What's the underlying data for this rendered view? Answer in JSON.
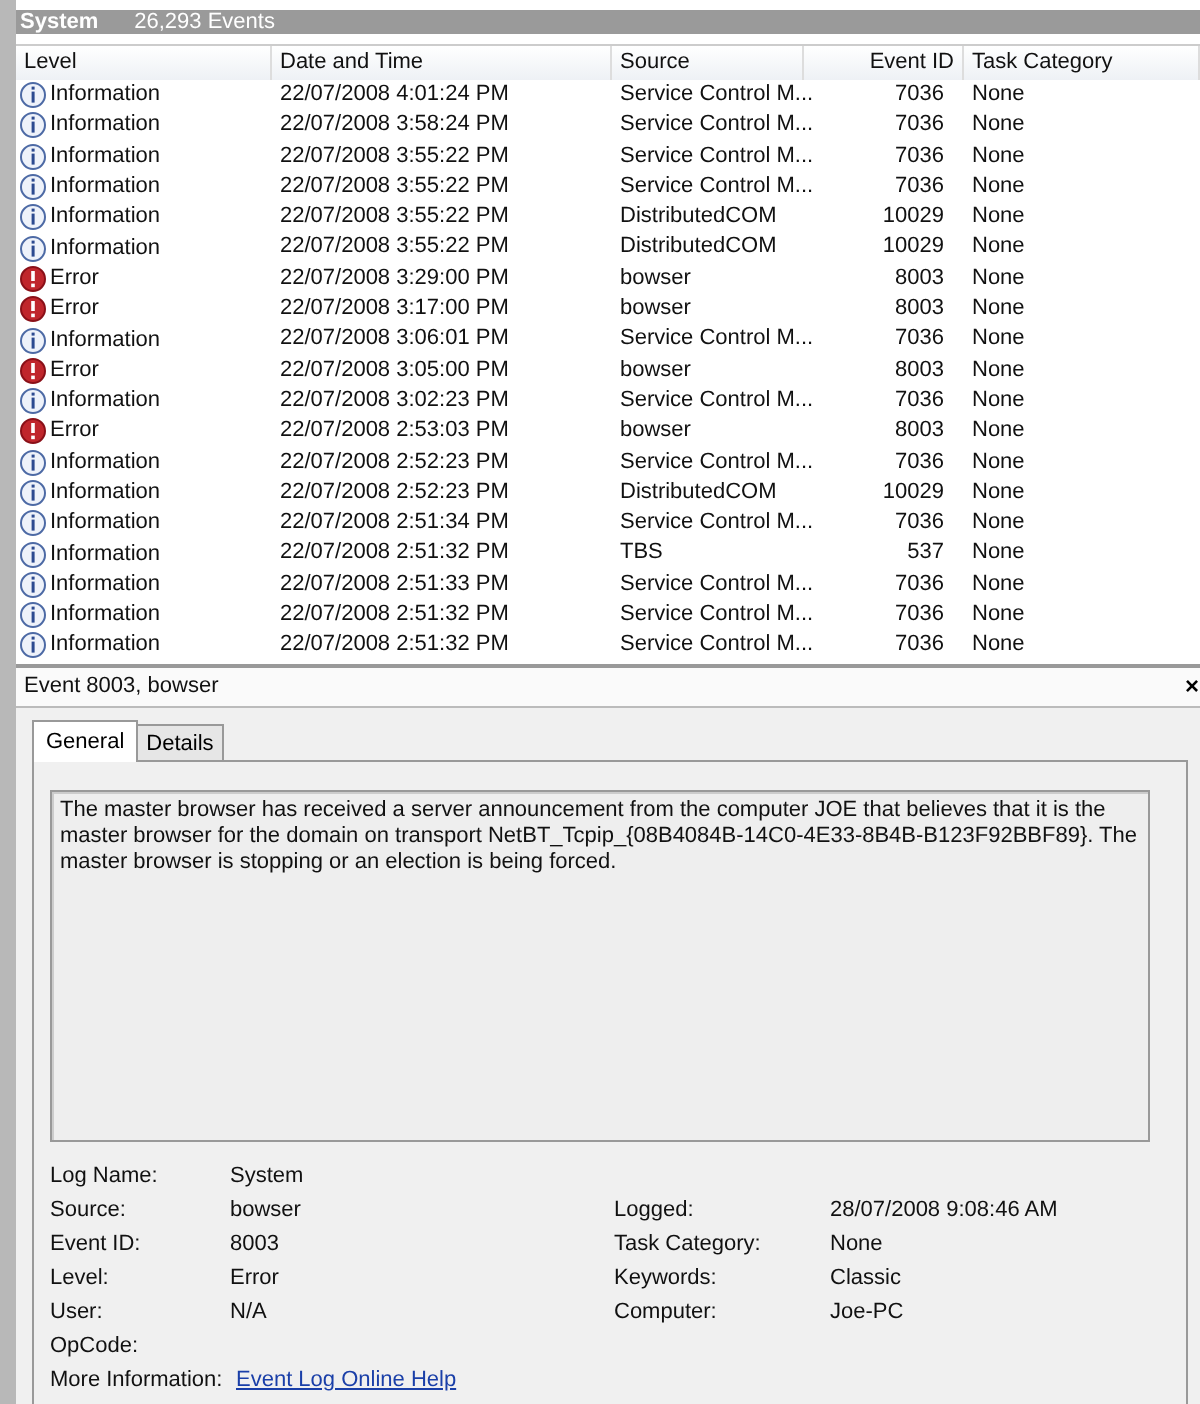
{
  "log_header": {
    "title": "System",
    "count": "26,293 Events"
  },
  "table": {
    "columns": [
      "Level",
      "Date and Time",
      "Source",
      "Event ID",
      "Task Category"
    ],
    "rows": [
      {
        "kind": "information",
        "level": "Information",
        "date": "22/07/2008 4:01:24 PM",
        "source": "Service Control M...",
        "event_id": "7036",
        "category": "None"
      },
      {
        "kind": "information",
        "level": "Information",
        "date": "22/07/2008 3:58:24 PM",
        "source": "Service Control M...",
        "event_id": "7036",
        "category": "None"
      },
      {
        "kind": "information",
        "level": "Information",
        "date": "22/07/2008 3:55:22 PM",
        "source": "Service Control M...",
        "event_id": "7036",
        "category": "None"
      },
      {
        "kind": "information",
        "level": "Information",
        "date": "22/07/2008 3:55:22 PM",
        "source": "Service Control M...",
        "event_id": "7036",
        "category": "None"
      },
      {
        "kind": "information",
        "level": "Information",
        "date": "22/07/2008 3:55:22 PM",
        "source": "DistributedCOM",
        "event_id": "10029",
        "category": "None"
      },
      {
        "kind": "information",
        "level": "Information",
        "date": "22/07/2008 3:55:22 PM",
        "source": "DistributedCOM",
        "event_id": "10029",
        "category": "None"
      },
      {
        "kind": "error",
        "level": "Error",
        "date": "22/07/2008 3:29:00 PM",
        "source": "bowser",
        "event_id": "8003",
        "category": "None"
      },
      {
        "kind": "error",
        "level": "Error",
        "date": "22/07/2008 3:17:00 PM",
        "source": "bowser",
        "event_id": "8003",
        "category": "None"
      },
      {
        "kind": "information",
        "level": "Information",
        "date": "22/07/2008 3:06:01 PM",
        "source": "Service Control M...",
        "event_id": "7036",
        "category": "None"
      },
      {
        "kind": "error",
        "level": "Error",
        "date": "22/07/2008 3:05:00 PM",
        "source": "bowser",
        "event_id": "8003",
        "category": "None"
      },
      {
        "kind": "information",
        "level": "Information",
        "date": "22/07/2008 3:02:23 PM",
        "source": "Service Control M...",
        "event_id": "7036",
        "category": "None"
      },
      {
        "kind": "error",
        "level": "Error",
        "date": "22/07/2008 2:53:03 PM",
        "source": "bowser",
        "event_id": "8003",
        "category": "None"
      },
      {
        "kind": "information",
        "level": "Information",
        "date": "22/07/2008 2:52:23 PM",
        "source": "Service Control M...",
        "event_id": "7036",
        "category": "None"
      },
      {
        "kind": "information",
        "level": "Information",
        "date": "22/07/2008 2:52:23 PM",
        "source": "DistributedCOM",
        "event_id": "10029",
        "category": "None"
      },
      {
        "kind": "information",
        "level": "Information",
        "date": "22/07/2008 2:51:34 PM",
        "source": "Service Control M...",
        "event_id": "7036",
        "category": "None"
      },
      {
        "kind": "information",
        "level": "Information",
        "date": "22/07/2008 2:51:32 PM",
        "source": "TBS",
        "event_id": "537",
        "category": "None"
      },
      {
        "kind": "information",
        "level": "Information",
        "date": "22/07/2008 2:51:33 PM",
        "source": "Service Control M...",
        "event_id": "7036",
        "category": "None"
      },
      {
        "kind": "information",
        "level": "Information",
        "date": "22/07/2008 2:51:32 PM",
        "source": "Service Control M...",
        "event_id": "7036",
        "category": "None"
      },
      {
        "kind": "information",
        "level": "Information",
        "date": "22/07/2008 2:51:32 PM",
        "source": "Service Control M...",
        "event_id": "7036",
        "category": "None"
      }
    ]
  },
  "detail": {
    "title": "Event 8003, bowser",
    "close": "×",
    "tabs": [
      {
        "label": "General",
        "selected": true
      },
      {
        "label": "Details",
        "selected": false
      }
    ],
    "message": "The master browser has received a server announcement from the computer JOE that believes that it is the master browser for the domain on transport NetBT_Tcpip_{08B4084B-14C0-4E33-8B4B-B123F92BBF89}. The master browser is stopping or an election is being forced.",
    "fields_left": [
      {
        "label": "Log Name:",
        "value": "System"
      },
      {
        "label": "Source:",
        "value": "bowser"
      },
      {
        "label": "Event ID:",
        "value": "8003"
      },
      {
        "label": "Level:",
        "value": "Error"
      },
      {
        "label": "User:",
        "value": "N/A"
      },
      {
        "label": "OpCode:"
      }
    ],
    "fields_right": [
      {
        "label": "Logged:",
        "value": "28/07/2008 9:08:46 AM"
      },
      {
        "label": "Task Category:",
        "value": "None"
      },
      {
        "label": "Keywords:",
        "value": "Classic"
      },
      {
        "label": "Computer:",
        "value": "Joe-PC"
      }
    ],
    "more_info": {
      "label": "More Information:",
      "link": "Event Log Online Help"
    }
  }
}
